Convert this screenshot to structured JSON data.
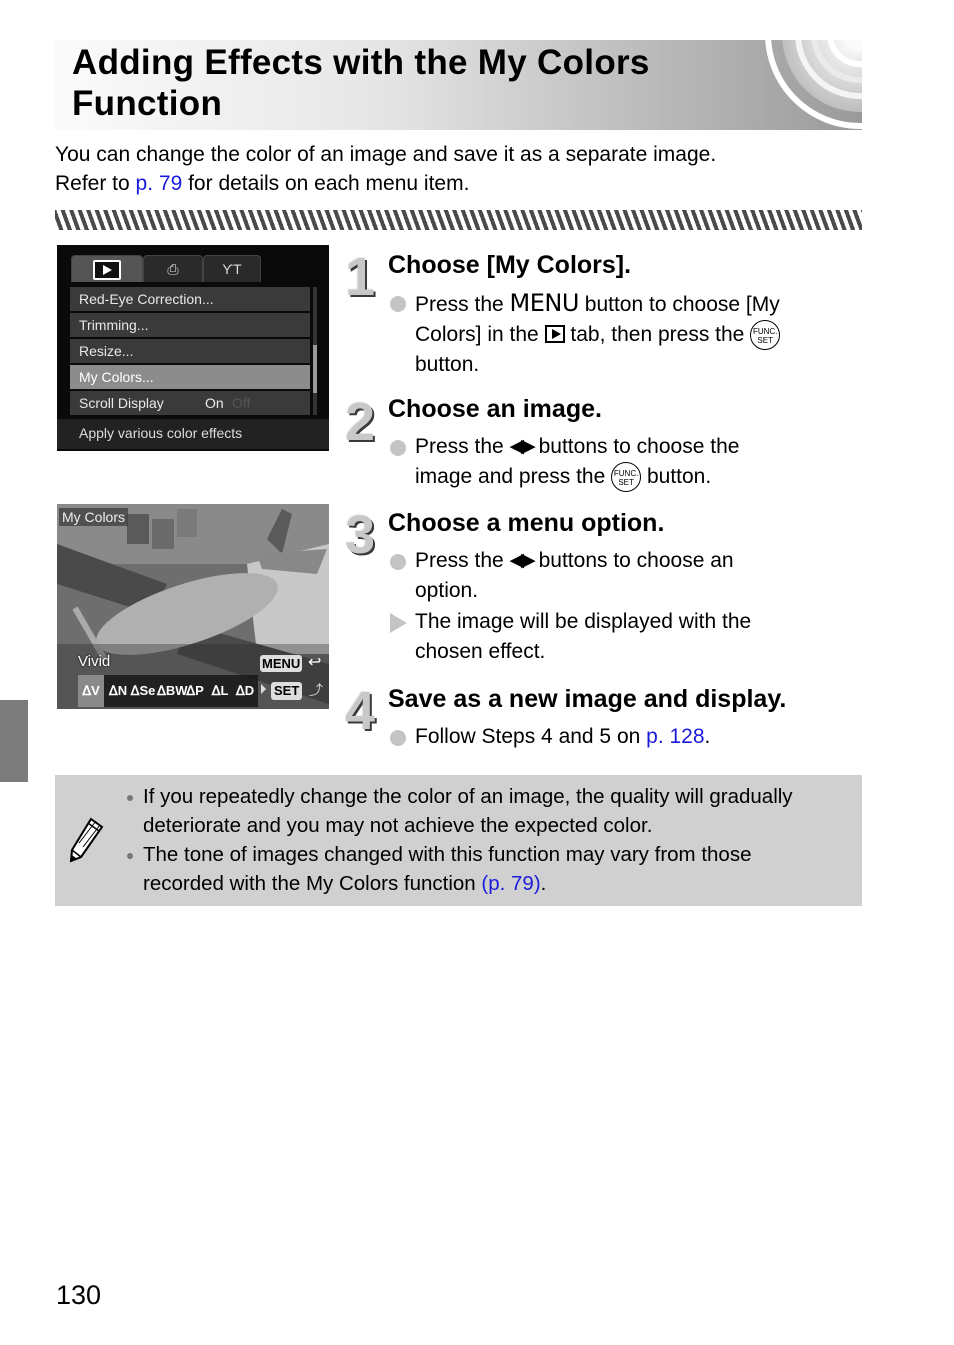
{
  "header": {
    "title_line1": "Adding Effects with the My Colors",
    "title_line2": "Function"
  },
  "intro": {
    "line1": "You can change the color of an image and save it as a separate image.",
    "line2_before": "Refer to ",
    "line2_link": "p. 79",
    "line2_after": " for details on each menu item."
  },
  "camera_menu": {
    "tabs": [
      "play-tab",
      "print-tab",
      "settings-tab"
    ],
    "items": [
      {
        "label": "Red-Eye Correction..."
      },
      {
        "label": "Trimming..."
      },
      {
        "label": "Resize..."
      },
      {
        "label": "My Colors...",
        "selected": true
      },
      {
        "label": "Scroll Display",
        "value_on": "On",
        "value_off": "Off"
      }
    ],
    "hint": "Apply various color effects"
  },
  "camera_photo": {
    "title": "My Colors",
    "current_effect": "Vivid",
    "menu_button": "MENU",
    "set_button": "SET",
    "effects": [
      {
        "label": "ᐃV",
        "selected": true
      },
      {
        "label": "ᐃN"
      },
      {
        "label": "ᐃSe"
      },
      {
        "label": "ᐃBW"
      },
      {
        "label": "ᐃP"
      },
      {
        "label": "ᐃL"
      },
      {
        "label": "ᐃD"
      }
    ]
  },
  "steps": [
    {
      "number": "1",
      "title": "Choose [My Colors].",
      "body": {
        "t1": "Press the ",
        "menu_word": "MENU",
        "t2": " button to choose [My",
        "t3": "Colors] in the ",
        "t4": " tab, then press the ",
        "t5": "button."
      }
    },
    {
      "number": "2",
      "title": "Choose an image.",
      "body": {
        "t1": "Press the ",
        "arrows": "◀▶",
        "t2": " buttons to choose the",
        "t3": "image and press the ",
        "t4": " button."
      }
    },
    {
      "number": "3",
      "title": "Choose a menu option.",
      "body": {
        "t1": "Press the ",
        "arrows": "◀▶",
        "t2": " buttons to choose an",
        "t3": "option.",
        "result1": "The image will be displayed with the",
        "result2": "chosen effect."
      }
    },
    {
      "number": "4",
      "title": "Save as a new image and display.",
      "body": {
        "t1": "Follow Steps 4 and 5 on ",
        "link": "p. 128",
        "t2": "."
      }
    }
  ],
  "func_icon": {
    "top": "FUNC.",
    "bottom": "SET"
  },
  "note": {
    "icon": "pencil-icon",
    "items": [
      {
        "line1": "If you repeatedly change the color of an image, the quality will gradually",
        "line2": "deteriorate and you may not achieve the expected color."
      },
      {
        "line1": "The tone of images changed with this function may vary from those",
        "line2_before": "recorded with the My Colors function ",
        "link": "(p. 79)",
        "line2_after": "."
      }
    ]
  },
  "page_number": "130"
}
